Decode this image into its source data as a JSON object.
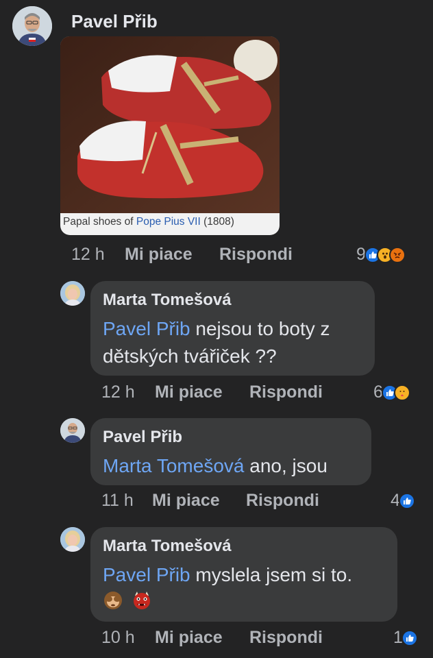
{
  "post": {
    "author": "Pavel Přib",
    "image_caption_prefix": "Papal shoes of ",
    "image_caption_link": "Pope Pius VII",
    "image_caption_suffix": " (1808)",
    "time": "12 h",
    "like_label": "Mi piace",
    "reply_label": "Rispondi",
    "reaction_count": "9",
    "reactions": [
      "like-icon",
      "wow-icon",
      "angry-icon"
    ]
  },
  "replies": [
    {
      "author": "Marta Tomešová",
      "mention": "Pavel Přib",
      "text": " nejsou to boty z dětských tvářiček ??",
      "time": "12 h",
      "like_label": "Mi piace",
      "reply_label": "Rispondi",
      "reaction_count": "6",
      "reactions": [
        "like-icon",
        "care-icon"
      ]
    },
    {
      "author": "Pavel Přib",
      "mention": "Marta Tomešová",
      "text": " ano, jsou",
      "time": "11 h",
      "like_label": "Mi piace",
      "reply_label": "Rispondi",
      "reaction_count": "4",
      "reactions": [
        "like-icon"
      ]
    },
    {
      "author": "Marta Tomešová",
      "mention": "Pavel Přib",
      "text": " myslela jsem si to.",
      "emojis": [
        "see-no-evil-monkey-icon",
        "ogre-icon"
      ],
      "time": "10 h",
      "like_label": "Mi piace",
      "reply_label": "Rispondi",
      "reaction_count": "1",
      "reactions": [
        "like-icon"
      ]
    }
  ],
  "colors": {
    "background": "#232324",
    "bubble": "#3a3b3c",
    "mention": "#6ea6f4",
    "like": "#1b74e4"
  }
}
